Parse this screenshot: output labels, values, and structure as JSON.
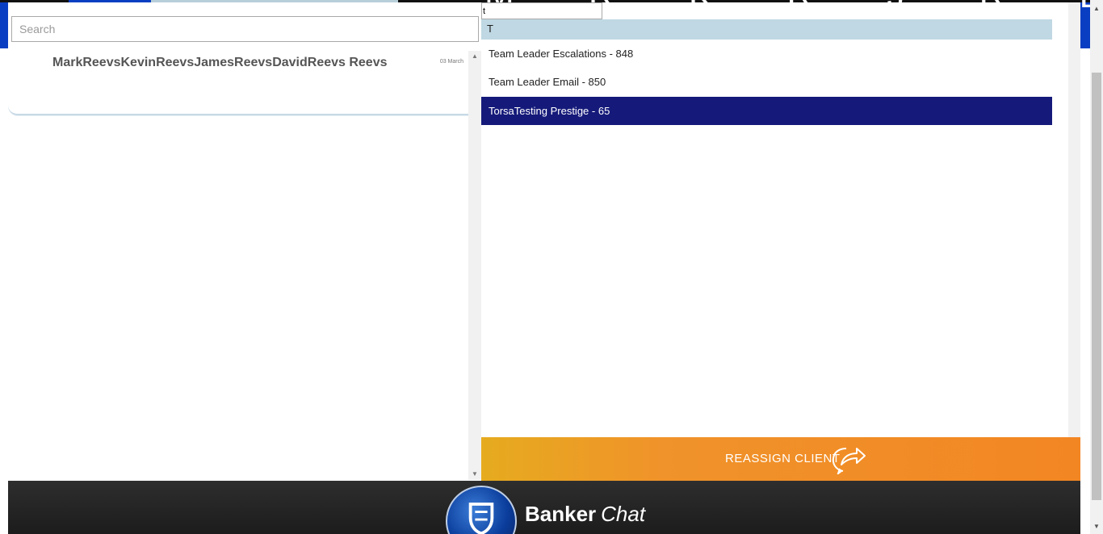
{
  "background": {
    "names_text": "M R K R J R D R"
  },
  "chat_list": {
    "search_placeholder": "Search",
    "items": [
      {
        "name": "MarkReevsKevinReevsJamesReevsDavidReevs Reevs",
        "date": "03 March"
      }
    ]
  },
  "reassign": {
    "filter_value": "t",
    "group_label": "T",
    "options": [
      {
        "label": "Team Leader Escalations - 848",
        "selected": false
      },
      {
        "label": "Team Leader Email - 850",
        "selected": false
      },
      {
        "label": "TorsaTesting Prestige - 65",
        "selected": true
      }
    ],
    "button_label": "REASSIGN CLIENT",
    "button_icon": "share-arrow-icon"
  },
  "footer": {
    "brand_bold": "Banker",
    "brand_italic": "Chat",
    "logo_icon": "shield-logo-icon"
  },
  "colors": {
    "header_blue": "#0a3ec2",
    "selected_row": "#151a7a",
    "group_header": "#bfd8e3",
    "reassign_orange": "#f28623"
  }
}
